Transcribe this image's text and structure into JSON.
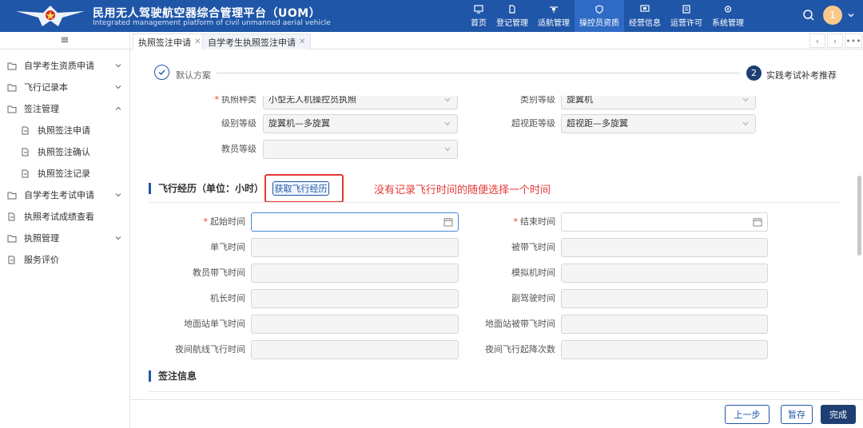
{
  "header": {
    "title": "民用无人驾驶航空器综合管理平台（UOM）",
    "subtitle": "Integrated management platform of civil unmanned aerial vehicle",
    "nav": [
      {
        "label": "首页",
        "icon": "monitor-icon"
      },
      {
        "label": "登记管理",
        "icon": "document-icon"
      },
      {
        "label": "适航管理",
        "icon": "drone-icon"
      },
      {
        "label": "操控员资质",
        "icon": "shield-icon",
        "active": true
      },
      {
        "label": "经营信息",
        "icon": "screen-icon"
      },
      {
        "label": "运营许可",
        "icon": "permit-icon"
      },
      {
        "label": "系统管理",
        "icon": "settings-icon"
      }
    ],
    "avatar_text": "1"
  },
  "sidebar": {
    "items": [
      {
        "label": "自学考生资质申请",
        "icon": "folder-icon",
        "expandable": true,
        "expanded": false
      },
      {
        "label": "飞行记录本",
        "icon": "folder-icon",
        "expandable": true,
        "expanded": false
      },
      {
        "label": "签注管理",
        "icon": "folder-icon",
        "expandable": true,
        "expanded": true
      },
      {
        "label": "执照签注申请",
        "icon": "file-icon",
        "child": true
      },
      {
        "label": "执照签注确认",
        "icon": "file-icon",
        "child": true
      },
      {
        "label": "执照签注记录",
        "icon": "file-icon",
        "child": true
      },
      {
        "label": "自学考生考试申请",
        "icon": "folder-icon",
        "expandable": true,
        "expanded": false
      },
      {
        "label": "执照考试成绩查看",
        "icon": "file-icon"
      },
      {
        "label": "执照管理",
        "icon": "folder-icon",
        "expandable": true,
        "expanded": false
      },
      {
        "label": "服务评价",
        "icon": "file-icon"
      }
    ]
  },
  "tabs": [
    {
      "label": "执照签注申请",
      "active": false
    },
    {
      "label": "自学考生执照签注申请",
      "active": true
    }
  ],
  "steps": [
    {
      "label": "默认方案",
      "status": "done"
    },
    {
      "label": "实践考试补考推荐",
      "number": "2",
      "status": "current"
    }
  ],
  "license_fields": {
    "license_type": {
      "label": "执照种类",
      "value": "小型无人机操控员执照",
      "required": true
    },
    "category_level": {
      "label": "类别等级",
      "value": "旋翼机"
    },
    "class_level": {
      "label": "级别等级",
      "value": "旋翼机—多旋翼"
    },
    "bvlos_level": {
      "label": "超视距等级",
      "value": "超视距—多旋翼"
    },
    "instructor_level": {
      "label": "教员等级",
      "value": ""
    }
  },
  "flight_section": {
    "title": "飞行经历（单位：小时）",
    "fetch_button": "获取飞行经历",
    "annotation": "没有记录飞行时间的随便选择一个时间",
    "fields": [
      {
        "label": "起始时间",
        "value": "",
        "required": true
      },
      {
        "label": "结束时间",
        "value": "",
        "required": true
      },
      {
        "label": "单飞时间",
        "value": ""
      },
      {
        "label": "被带飞时间",
        "value": ""
      },
      {
        "label": "教员带飞时间",
        "value": ""
      },
      {
        "label": "模拟机时间",
        "value": ""
      },
      {
        "label": "机长时间",
        "value": ""
      },
      {
        "label": "副驾驶时间",
        "value": ""
      },
      {
        "label": "地面站单飞时间",
        "value": ""
      },
      {
        "label": "地面站被带飞时间",
        "value": ""
      },
      {
        "label": "夜间航线飞行时间",
        "value": ""
      },
      {
        "label": "夜间飞行起降次数",
        "value": ""
      }
    ]
  },
  "endorse_section": {
    "title": "签注信息"
  },
  "footer": {
    "prev": "上一步",
    "save": "暂存",
    "finish": "完成"
  },
  "colors": {
    "primary": "#1f56a8",
    "annotation_red": "#e53935",
    "button_dark": "#1f3f73"
  }
}
